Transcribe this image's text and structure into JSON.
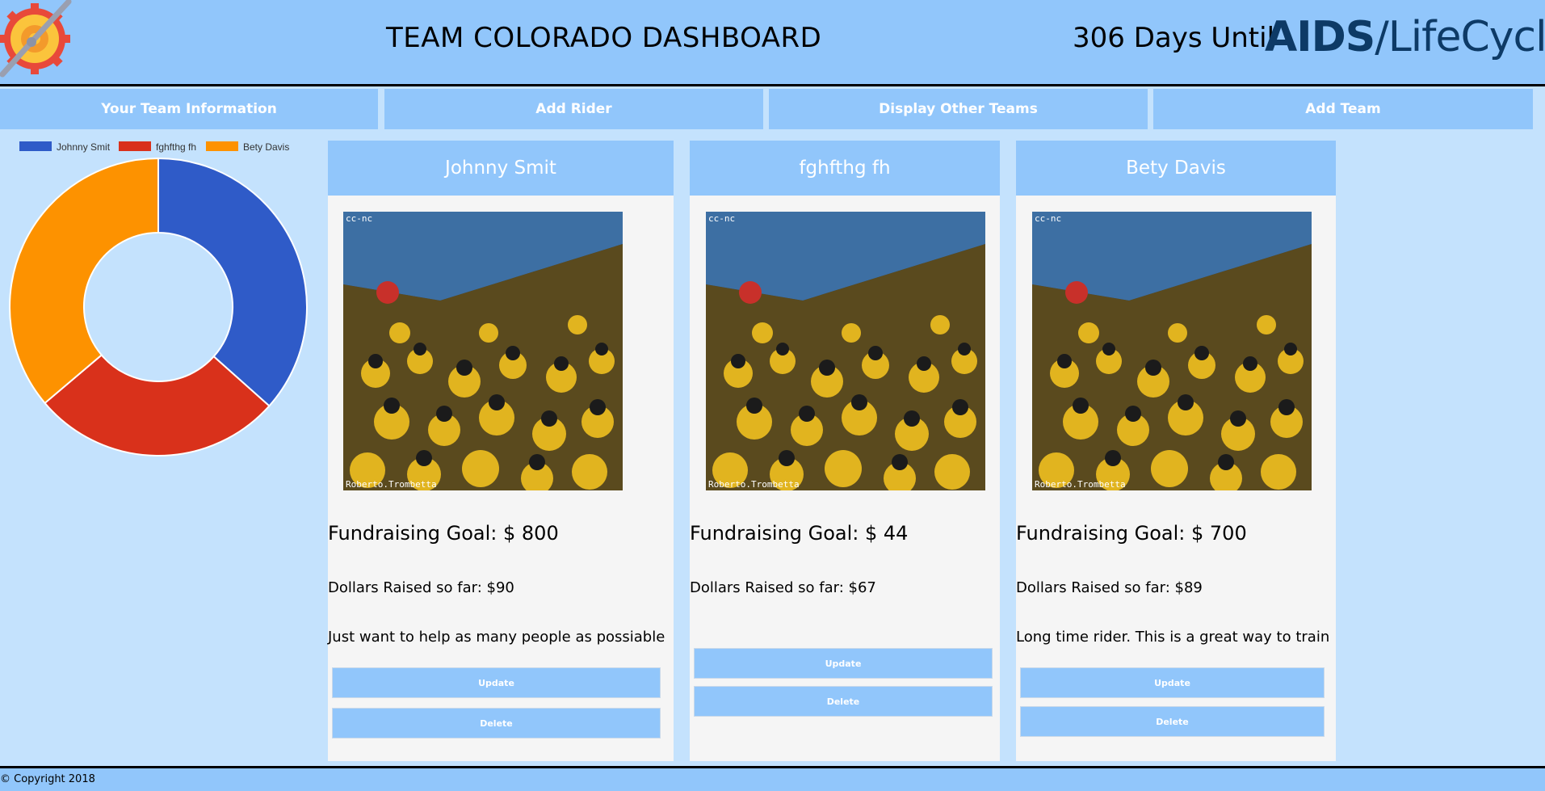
{
  "header": {
    "title": "TEAM COLORADO DASHBOARD",
    "countdown": "306 Days Until",
    "brand_bold": "AIDS",
    "brand_slash": "/",
    "brand_light": "LifeCycle",
    "brand_mark": "®",
    "logo_icon": "bike-gear-logo-icon"
  },
  "nav": [
    {
      "label": "Your Team Information"
    },
    {
      "label": "Add Rider"
    },
    {
      "label": "Display Other Teams"
    },
    {
      "label": "Add Team"
    }
  ],
  "chart_data": {
    "type": "pie",
    "subtype": "doughnut",
    "categories": [
      "Johnny Smit",
      "fghfthg fh",
      "Bety Davis"
    ],
    "values": [
      90,
      67,
      89
    ],
    "colors": [
      "#2f5bc8",
      "#d9311b",
      "#fd9200"
    ],
    "legend_placement": "top"
  },
  "riders": [
    {
      "name": "Johnny Smit",
      "photo_watermark_top": "cc-nc",
      "photo_watermark_bottom": "Roberto.Trombetta",
      "goal": "Fundraising Goal: $ 800",
      "raised": "Dollars Raised so far: $90",
      "bio": "Just want to help as many people as possiable",
      "update_label": "Update",
      "delete_label": "Delete"
    },
    {
      "name": "fghfthg fh",
      "photo_watermark_top": "cc-nc",
      "photo_watermark_bottom": "Roberto.Trombetta",
      "goal": "Fundraising Goal: $ 44",
      "raised": "Dollars Raised so far: $67",
      "bio": "",
      "update_label": "Update",
      "delete_label": "Delete"
    },
    {
      "name": "Bety Davis",
      "photo_watermark_top": "cc-nc",
      "photo_watermark_bottom": "Roberto.Trombetta",
      "goal": "Fundraising Goal: $ 700",
      "raised": "Dollars Raised so far: $89",
      "bio": "Long time rider. This is a great way to train",
      "update_label": "Update",
      "delete_label": "Delete"
    }
  ],
  "footer": {
    "copyright": "© Copyright 2018"
  }
}
